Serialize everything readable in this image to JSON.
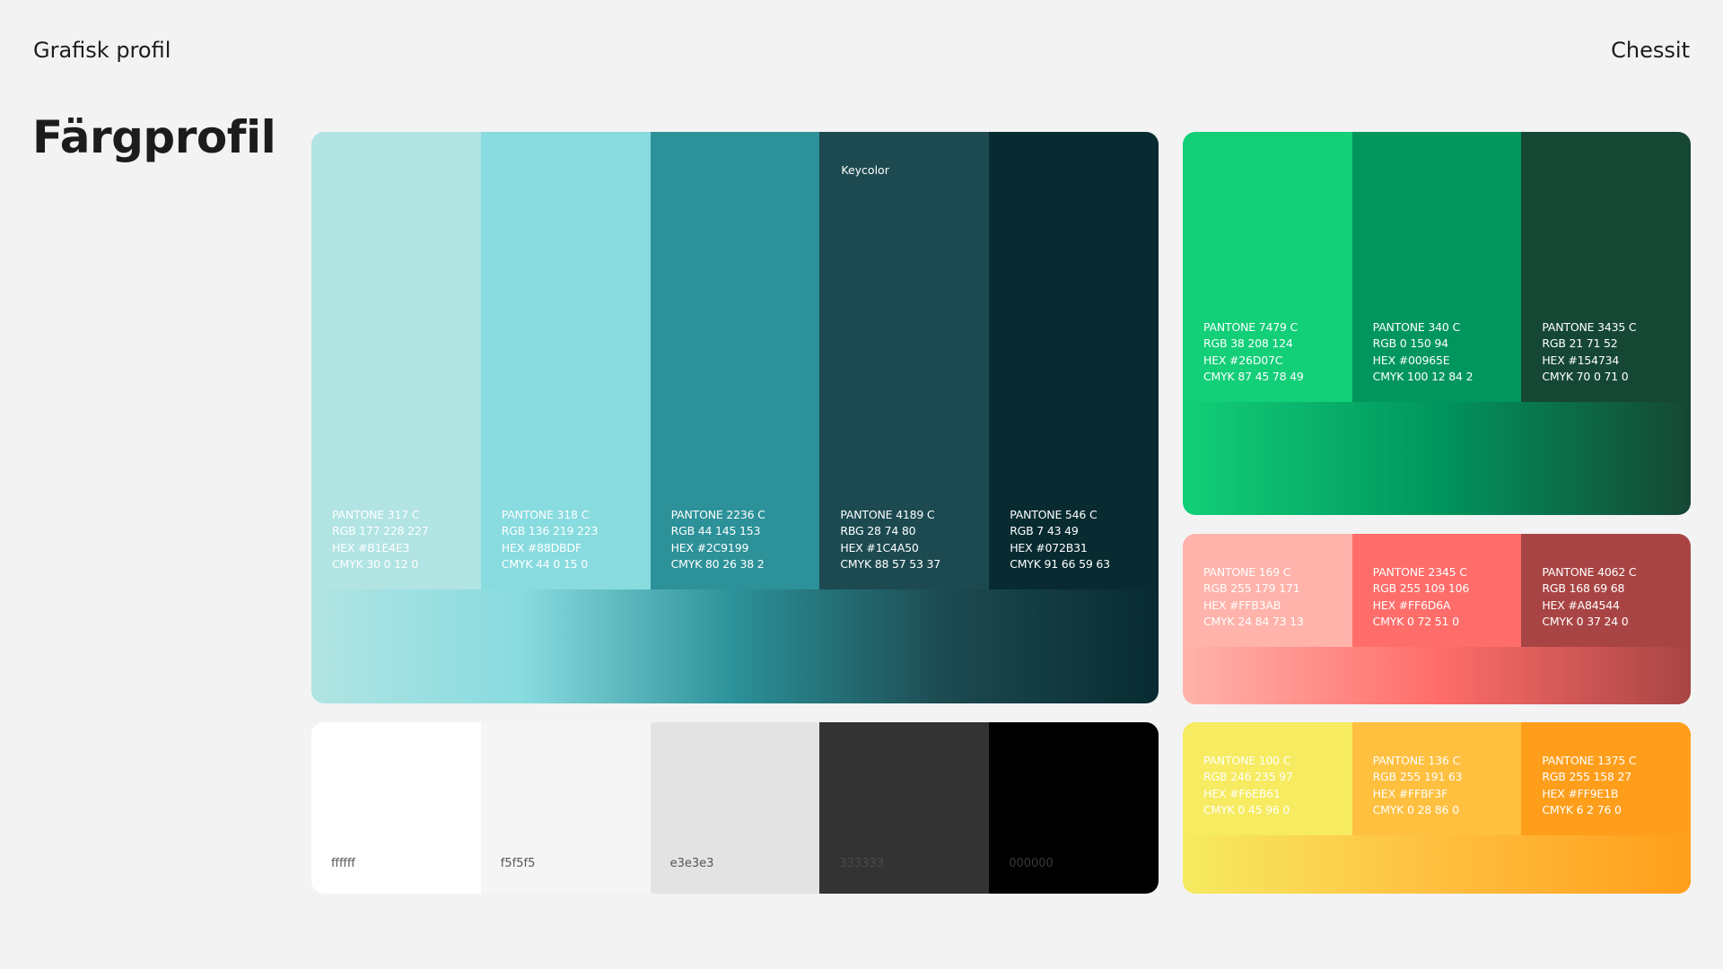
{
  "header": {
    "left": "Grafisk profil",
    "right": "Chessit"
  },
  "page_title": "Färgprofil",
  "keycolor_label": "Keycolor",
  "teal": [
    {
      "color": "#B1E4E3",
      "text_color": "#ffffff",
      "pantone": "PANTONE 317 C",
      "rgb": "RGB 177 228 227",
      "hex": "HEX #B1E4E3",
      "cmyk": "CMYK 30 0 12 0"
    },
    {
      "color": "#88DBDF",
      "text_color": "#ffffff",
      "pantone": "PANTONE 318 C",
      "rgb": "RGB 136 219 223",
      "hex": "HEX #88DBDF",
      "cmyk": "CMYK 44 0 15 0"
    },
    {
      "color": "#2C9199",
      "text_color": "#ffffff",
      "pantone": "PANTONE 2236 C",
      "rgb": "RGB 44 145 153",
      "hex": "HEX #2C9199",
      "cmyk": "CMYK 80 26 38 2"
    },
    {
      "color": "#1C4A50",
      "text_color": "#ffffff",
      "pantone": "PANTONE 4189 C",
      "rgb": "RBG 28 74 80",
      "hex": "HEX #1C4A50",
      "cmyk": "CMYK 88 57 53 37"
    },
    {
      "color": "#072B31",
      "text_color": "#ffffff",
      "pantone": "PANTONE 546 C",
      "rgb": "RGB 7 43 49",
      "hex": "HEX #072B31",
      "cmyk": "CMYK 91 66 59 63"
    }
  ],
  "neutrals": [
    {
      "color": "#ffffff",
      "text_color": "#555555",
      "label": "ffffff"
    },
    {
      "color": "#f5f5f5",
      "text_color": "#555555",
      "label": "f5f5f5"
    },
    {
      "color": "#e3e3e3",
      "text_color": "#555555",
      "label": "e3e3e3"
    },
    {
      "color": "#333333",
      "text_color": "#4a4a4a",
      "label": "333333"
    },
    {
      "color": "#000000",
      "text_color": "#3a3a3a",
      "label": "000000"
    }
  ],
  "green": [
    {
      "color": "#13CF78",
      "text_color": "#ffffff",
      "pantone": "PANTONE 7479 C",
      "rgb": "RGB 38 208 124",
      "hex": "HEX #26D07C",
      "cmyk": "CMYK 87 45 78 49"
    },
    {
      "color": "#00965E",
      "text_color": "#ffffff",
      "pantone": "PANTONE 340 C",
      "rgb": "RGB 0 150 94",
      "hex": "HEX #00965E",
      "cmyk": "CMYK 100 12 84 2"
    },
    {
      "color": "#154734",
      "text_color": "#ffffff",
      "pantone": "PANTONE 3435 C",
      "rgb": "RGB 21 71 52",
      "hex": "HEX #154734",
      "cmyk": "CMYK 70 0 71 0"
    }
  ],
  "red": [
    {
      "color": "#FFB3AB",
      "text_color": "#ffffff",
      "pantone": "PANTONE 169 C",
      "rgb": "RGB 255 179 171",
      "hex": "HEX #FFB3AB",
      "cmyk": "CMYK 24 84 73 13"
    },
    {
      "color": "#FF6D6A",
      "text_color": "#ffffff",
      "pantone": "PANTONE 2345 C",
      "rgb": "RGB 255 109 106",
      "hex": "HEX #FF6D6A",
      "cmyk": "CMYK 0 72 51 0"
    },
    {
      "color": "#A84544",
      "text_color": "#ffffff",
      "pantone": "PANTONE 4062 C",
      "rgb": "RGB 168 69 68",
      "hex": "HEX #A84544",
      "cmyk": "CMYK 0 37 24 0"
    }
  ],
  "yellow": [
    {
      "color": "#F6EB61",
      "text_color": "#ffffff",
      "pantone": "PANTONE 100 C",
      "rgb": "RGB 246 235 97",
      "hex": "HEX #F6EB61",
      "cmyk": "CMYK 0 45 96 0"
    },
    {
      "color": "#FFBF3F",
      "text_color": "#ffffff",
      "pantone": "PANTONE 136 C",
      "rgb": "RGB 255 191 63",
      "hex": "HEX #FFBF3F",
      "cmyk": "CMYK 0 28 86 0"
    },
    {
      "color": "#FF9E1B",
      "text_color": "#ffffff",
      "pantone": "PANTONE 1375 C",
      "rgb": "RGB 255 158 27",
      "hex": "HEX #FF9E1B",
      "cmyk": "CMYK 6 2 76 0"
    }
  ]
}
